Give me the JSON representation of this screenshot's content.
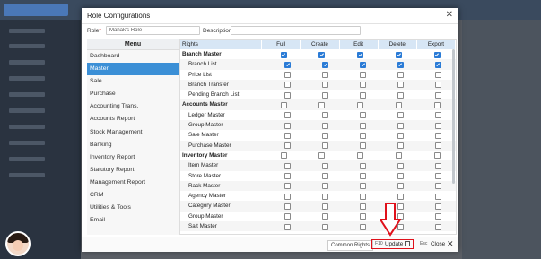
{
  "modal": {
    "title": "Role Configurations",
    "role_label": "Role",
    "role_required": "*",
    "role_value": "Mahak's Role",
    "description_label": "Description",
    "description_value": ""
  },
  "menu": {
    "header": "Menu",
    "items": [
      "Dashboard",
      "Master",
      "Sale",
      "Purchase",
      "Accounting Trans.",
      "Accounts Report",
      "Stock Management",
      "Banking",
      "Inventory Report",
      "Statutory Report",
      "Management Report",
      "CRM",
      "Utilities & Tools",
      "Email"
    ],
    "active": "Master"
  },
  "rights": {
    "columns": [
      "Rights",
      "Full",
      "Create",
      "Edit",
      "Delete",
      "Export"
    ],
    "rows": [
      {
        "name": "Branch Master",
        "type": "group",
        "checks": [
          true,
          true,
          true,
          true,
          true
        ]
      },
      {
        "name": "Branch List",
        "type": "sub",
        "checks": [
          true,
          true,
          true,
          true,
          true
        ]
      },
      {
        "name": "Price List",
        "type": "sub",
        "checks": [
          false,
          false,
          false,
          false,
          false
        ]
      },
      {
        "name": "Branch Transfer",
        "type": "sub",
        "checks": [
          false,
          false,
          false,
          false,
          false
        ]
      },
      {
        "name": "Pending Branch List",
        "type": "sub",
        "checks": [
          false,
          false,
          false,
          false,
          false
        ]
      },
      {
        "name": "Accounts Master",
        "type": "group",
        "checks": [
          false,
          false,
          false,
          false,
          false
        ]
      },
      {
        "name": "Ledger Master",
        "type": "sub",
        "checks": [
          false,
          false,
          false,
          false,
          false
        ]
      },
      {
        "name": "Group Master",
        "type": "sub",
        "checks": [
          false,
          false,
          false,
          false,
          false
        ]
      },
      {
        "name": "Sale Master",
        "type": "sub",
        "checks": [
          false,
          false,
          false,
          false,
          false
        ]
      },
      {
        "name": "Purchase Master",
        "type": "sub",
        "checks": [
          false,
          false,
          false,
          false,
          false
        ]
      },
      {
        "name": "Inventory Master",
        "type": "group",
        "checks": [
          false,
          false,
          false,
          false,
          false
        ]
      },
      {
        "name": "Item Master",
        "type": "sub",
        "checks": [
          false,
          false,
          false,
          false,
          false
        ]
      },
      {
        "name": "Store Master",
        "type": "sub",
        "checks": [
          false,
          false,
          false,
          false,
          false
        ]
      },
      {
        "name": "Rack Master",
        "type": "sub",
        "checks": [
          false,
          false,
          false,
          false,
          false
        ]
      },
      {
        "name": "Agency Master",
        "type": "sub",
        "checks": [
          false,
          false,
          false,
          false,
          false
        ]
      },
      {
        "name": "Category Master",
        "type": "sub",
        "checks": [
          false,
          false,
          false,
          false,
          false
        ]
      },
      {
        "name": "Group Master",
        "type": "sub",
        "checks": [
          false,
          false,
          false,
          false,
          false
        ]
      },
      {
        "name": "Salt Master",
        "type": "sub",
        "checks": [
          false,
          false,
          false,
          false,
          false
        ]
      }
    ]
  },
  "footer": {
    "common_rights": "Common Rights",
    "update_key": "F10",
    "update_label": "Update",
    "close_key": "Esc",
    "close_label": "Close"
  },
  "colors": {
    "accent": "#3b8fd6",
    "highlight": "#e0111b"
  }
}
